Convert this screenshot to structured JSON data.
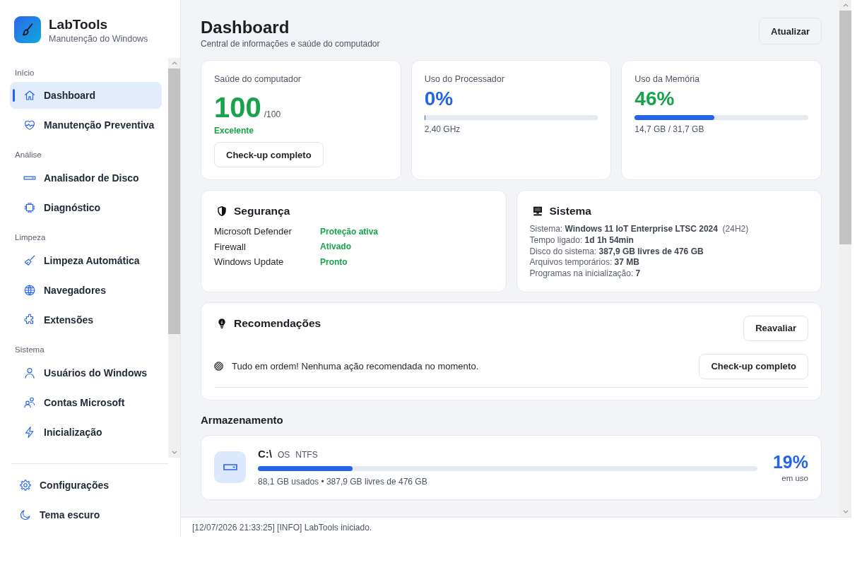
{
  "app": {
    "title": "LabTools",
    "subtitle": "Manutenção do Windows"
  },
  "sidebar": {
    "sections": [
      {
        "label": "Início",
        "items": [
          {
            "label": "Dashboard",
            "selected": true
          },
          {
            "label": "Manutenção Preventiva",
            "selected": false
          }
        ]
      },
      {
        "label": "Análise",
        "items": [
          {
            "label": "Analisador de Disco",
            "selected": false
          },
          {
            "label": "Diagnóstico",
            "selected": false
          }
        ]
      },
      {
        "label": "Limpeza",
        "items": [
          {
            "label": "Limpeza Automática",
            "selected": false
          },
          {
            "label": "Navegadores",
            "selected": false
          },
          {
            "label": "Extensões",
            "selected": false
          }
        ]
      },
      {
        "label": "Sistema",
        "items": [
          {
            "label": "Usuários do Windows",
            "selected": false
          },
          {
            "label": "Contas Microsoft",
            "selected": false
          },
          {
            "label": "Inicialização",
            "selected": false
          }
        ]
      }
    ],
    "footer_items": [
      {
        "label": "Configurações",
        "selected": false
      },
      {
        "label": "Tema escuro",
        "selected": false
      }
    ]
  },
  "header": {
    "title": "Dashboard",
    "subtitle": "Central de informações e saúde do computador",
    "button": "Atualizar"
  },
  "metrics": [
    {
      "kind": "score",
      "label": "Saúde do computador",
      "value": "100",
      "unit": "/100",
      "color": "#16a34a",
      "status": "Excelente",
      "button": "Check-up completo"
    },
    {
      "kind": "gauge",
      "label": "Uso do Processador",
      "value": "0%",
      "color": "#2563eb",
      "level": 0,
      "detail": "2,40 GHz"
    },
    {
      "kind": "gauge",
      "label": "Uso da Memória",
      "value": "46%",
      "color": "#16a34a",
      "level": 0.46,
      "detail": "14,7 GB / 31,7 GB"
    }
  ],
  "security": {
    "title": "Segurança",
    "rows": [
      {
        "label": "Microsoft Defender",
        "status": "Proteção ativa"
      },
      {
        "label": "Firewall",
        "status": "Ativado"
      },
      {
        "label": "Windows Update",
        "status": "Pronto"
      }
    ]
  },
  "system": {
    "title": "Sistema",
    "lines": [
      "Sistema: **Windows 11 IoT Enterprise LTSC 2024**  (24H2)",
      "Tempo ligado: **1d 1h 54min**",
      "Disco do sistema: **387,9 GB livres de 476 GB**",
      "Arquivos temporários: **37 MB**",
      "Programas na inicialização: **7**"
    ]
  },
  "recommendations": {
    "title": "Recomendações",
    "button": "Reavaliar",
    "items": [
      {
        "text": "Tudo em ordem! Nenhuma ação recomendada no momento.",
        "button": "Check-up completo"
      }
    ]
  },
  "storage": {
    "title": "Armazenamento",
    "drives": [
      {
        "name": "C:\\",
        "label": "OS",
        "filesystem": "NTFS",
        "level": 0.19,
        "usage": "88,1 GB usados • 387,9 GB livres de 476 GB",
        "percent": "19%",
        "percent_caption": "em uso"
      }
    ]
  },
  "status_bar": {
    "log": "[12/07/2026 21:33:25] [INFO] LabTools iniciado."
  }
}
